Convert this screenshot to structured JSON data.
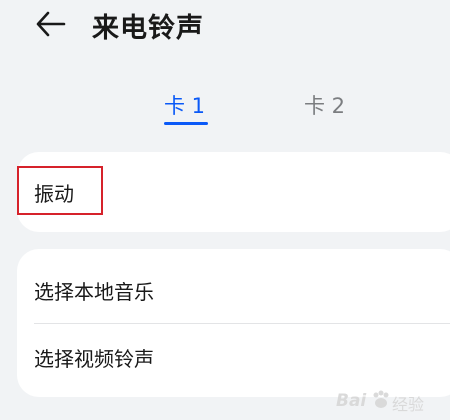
{
  "header": {
    "title": "来电铃声",
    "back_icon": "arrow-left-icon"
  },
  "tabs": [
    {
      "label": "卡 1",
      "active": true
    },
    {
      "label": "卡 2",
      "active": false
    }
  ],
  "settings": {
    "vibration_label": "振动",
    "local_music_label": "选择本地音乐",
    "video_ringtone_label": "选择视频铃声"
  },
  "watermark": {
    "brand": "Bai",
    "sub": "经验"
  },
  "colors": {
    "accent": "#0a59f7",
    "highlight": "#d6222b",
    "background": "#f1f3f5",
    "card": "#ffffff"
  }
}
